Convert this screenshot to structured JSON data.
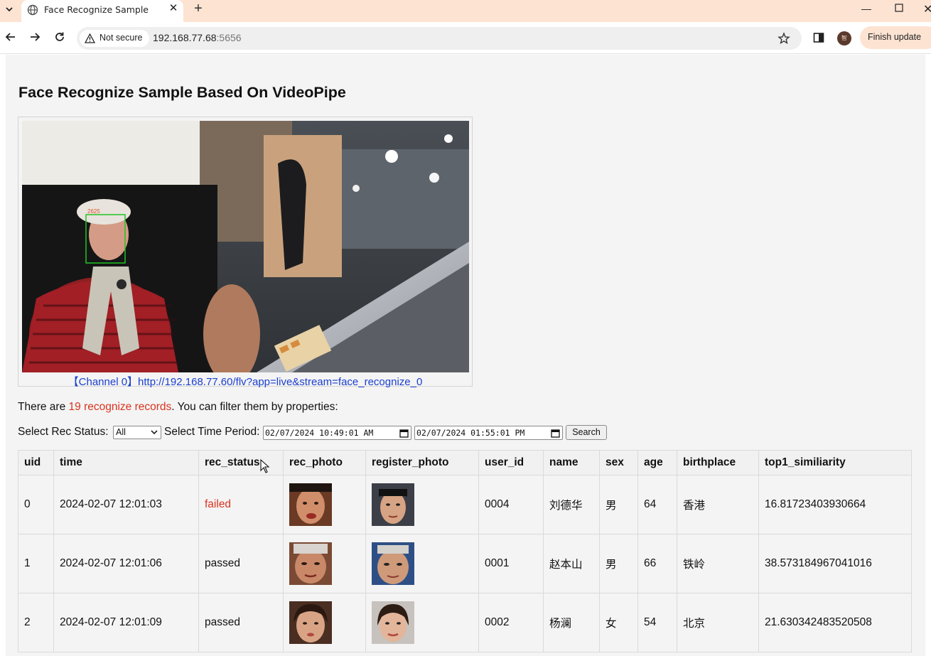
{
  "browser": {
    "tab_title": "Face Recognize Sample",
    "security_label": "Not secure",
    "url_host": "192.168.77.68",
    "url_port": ":5656",
    "update_label": "Finish update",
    "profile_initial": "智"
  },
  "page": {
    "title": "Face Recognize Sample Based On VideoPipe",
    "channel_caption": "【Channel 0】http://192.168.77.60/flv?app=live&stream=face_recognize_0",
    "overlay_label": "2625",
    "summary_prefix": "There are ",
    "summary_highlight": "19 recognize records",
    "summary_suffix": ". You can filter them by properties:"
  },
  "filters": {
    "status_label": "Select Rec Status:",
    "status_value": "All",
    "period_label": "Select Time Period:",
    "start_time": "02/07/2024 10:49:01 AM",
    "end_time": "02/07/2024 01:55:01 PM",
    "search_label": "Search"
  },
  "table": {
    "headers": [
      "uid",
      "time",
      "rec_status",
      "rec_photo",
      "register_photo",
      "user_id",
      "name",
      "sex",
      "age",
      "birthplace",
      "top1_similiarity"
    ],
    "rows": [
      {
        "uid": "0",
        "time": "2024-02-07 12:01:03",
        "rec_status": "failed",
        "user_id": "0004",
        "name": "刘德华",
        "sex": "男",
        "age": "64",
        "birthplace": "香港",
        "top1_similiarity": "16.81723403930664"
      },
      {
        "uid": "1",
        "time": "2024-02-07 12:01:06",
        "rec_status": "passed",
        "user_id": "0001",
        "name": "赵本山",
        "sex": "男",
        "age": "66",
        "birthplace": "铁岭",
        "top1_similiarity": "38.573184967041016"
      },
      {
        "uid": "2",
        "time": "2024-02-07 12:01:09",
        "rec_status": "passed",
        "user_id": "0002",
        "name": "杨澜",
        "sex": "女",
        "age": "54",
        "birthplace": "北京",
        "top1_similiarity": "21.630342483520508"
      }
    ]
  },
  "colors": {
    "accent_red": "#d9341f",
    "link_blue": "#1a3fcf",
    "tab_strip": "#fde3d2"
  }
}
